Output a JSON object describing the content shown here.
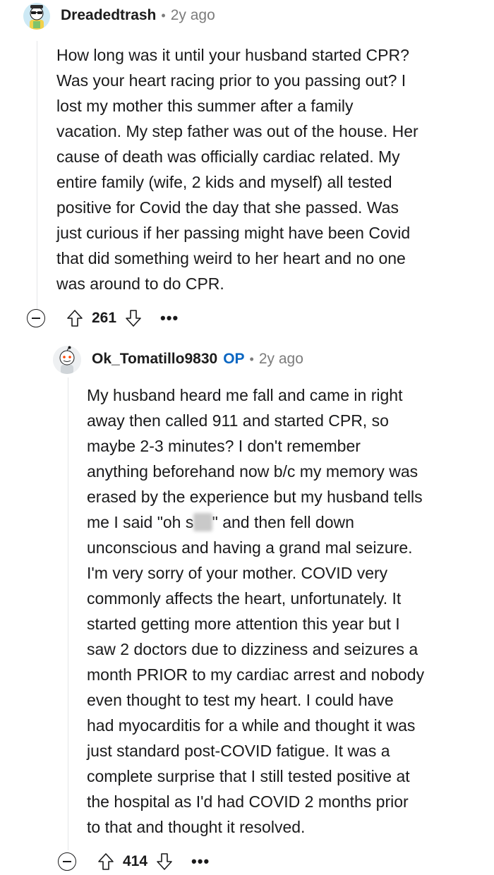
{
  "comment1": {
    "username": "Dreadedtrash",
    "time": "2y ago",
    "lines": [
      "How long was it until your husband started CPR?",
      "Was your heart racing prior to you passing out? I",
      "lost my mother this summer after a family",
      "vacation. My step father was out of the house. Her",
      "cause of death was officially cardiac related. My",
      "entire family (wife, 2 kids and myself) all tested",
      "positive for Covid the day that she passed. Was",
      "just curious if her passing might have been Covid",
      "that did something weird to her heart and no one",
      "was around to do CPR."
    ],
    "score": "261"
  },
  "comment2": {
    "username": "Ok_Tomatillo9830",
    "op_badge": "OP",
    "time": "2y ago",
    "lines_before": [
      "My husband heard me fall and came in right",
      "away then called 911 and started CPR, so",
      "maybe 2-3 minutes? I don't remember",
      "anything beforehand now b/c my memory was",
      "erased by the experience but my husband tells"
    ],
    "censored_line": {
      "before": "me I said \"oh s",
      "censored": "hit",
      "after": "\" and then fell down"
    },
    "lines_after": [
      "unconscious and having a grand mal seizure.",
      "I'm very sorry of your mother. COVID very",
      "commonly affects the heart, unfortunately. It",
      "started getting more attention this year but I",
      "saw 2 doctors due to dizziness and seizures a",
      "month PRIOR to my cardiac arrest and nobody",
      "even thought to test my heart. I could have",
      "had myocarditis for a while and thought it was",
      "just standard post-COVID fatigue. It was a",
      "complete surprise that I still tested positive at",
      "the hospital as I'd had COVID 2 months prior",
      "to that and thought it resolved."
    ],
    "score": "414"
  },
  "more_label": "•••",
  "separator": "•",
  "icons": [
    "avatar-sunglasses",
    "avatar-default",
    "collapse-icon",
    "upvote-icon",
    "downvote-icon",
    "more-icon"
  ]
}
